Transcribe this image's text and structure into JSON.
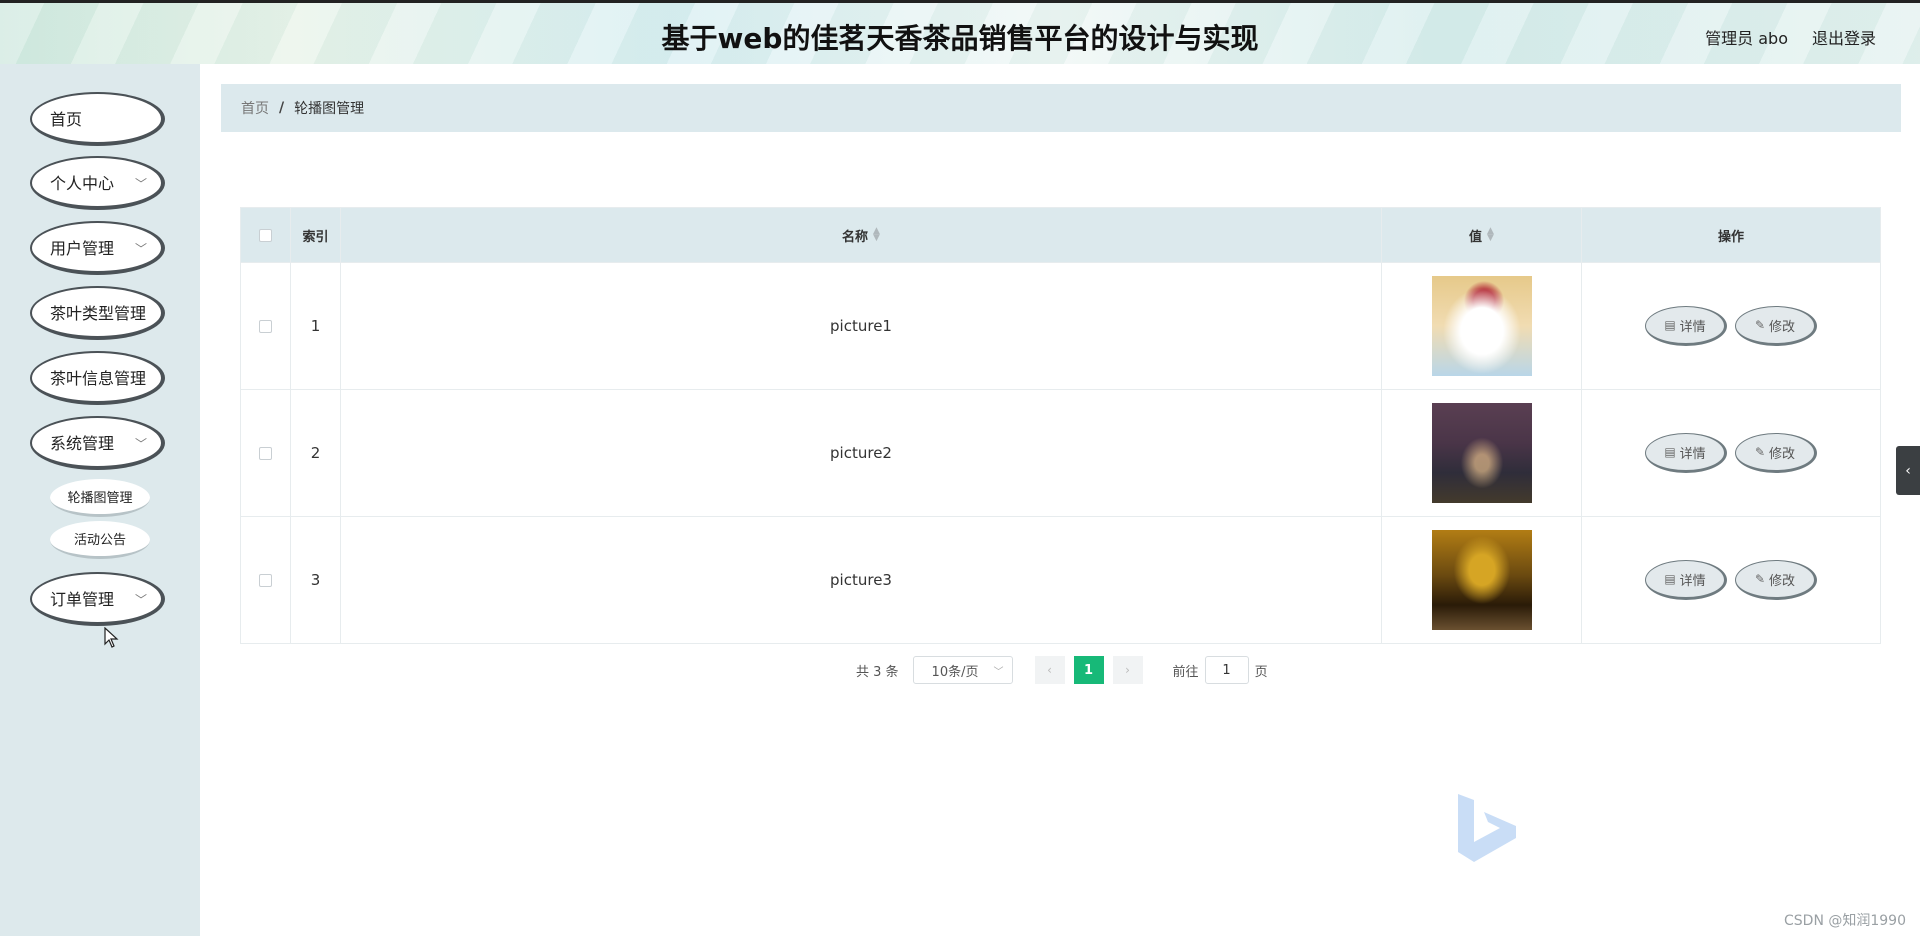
{
  "header": {
    "title": "基于web的佳茗天香茶品销售平台的设计与实现",
    "user": "管理员 abo",
    "logout": "退出登录"
  },
  "sidebar": {
    "items": [
      {
        "label": "首页"
      },
      {
        "label": "个人中心"
      },
      {
        "label": "用户管理"
      },
      {
        "label": "茶叶类型管理"
      },
      {
        "label": "茶叶信息管理"
      },
      {
        "label": "系统管理"
      },
      {
        "label": "订单管理"
      }
    ],
    "sub_items": [
      {
        "label": "轮播图管理"
      },
      {
        "label": "活动公告"
      }
    ],
    "chevron": "chevron-down-icon"
  },
  "breadcrumb": {
    "home": "首页",
    "separator": "/",
    "current": "轮播图管理"
  },
  "table": {
    "headers": {
      "index": "索引",
      "name": "名称",
      "value": "值",
      "actions": "操作"
    },
    "rows": [
      {
        "index": "1",
        "name": "picture1",
        "detail": "详情",
        "edit": "修改"
      },
      {
        "index": "2",
        "name": "picture2",
        "detail": "详情",
        "edit": "修改"
      },
      {
        "index": "3",
        "name": "picture3",
        "detail": "详情",
        "edit": "修改"
      }
    ]
  },
  "pagination": {
    "total": "共 3 条",
    "page_size": "10条/页",
    "current_page": "1",
    "goto_prefix": "前往",
    "goto_value": "1",
    "goto_suffix": "页"
  },
  "watermark": "CSDN @知润1990",
  "colors": {
    "accent": "#17b978",
    "sidebar_bg": "#dde9ec",
    "table_header_bg": "#dce9ed"
  }
}
